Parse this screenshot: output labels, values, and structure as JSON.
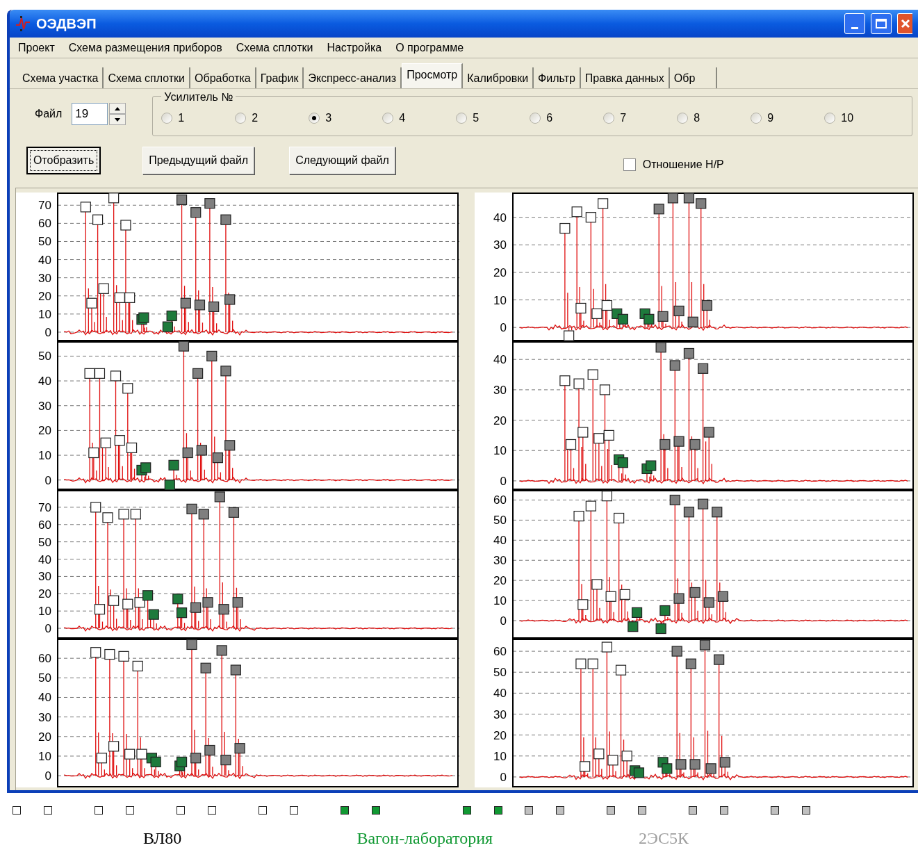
{
  "window": {
    "title": "ОЭДВЭП"
  },
  "menu": [
    "Проект",
    "Схема размещения приборов",
    "Схема сплотки",
    "Настройка",
    "О программе"
  ],
  "tabs": [
    {
      "label": "Схема участка",
      "selected": false
    },
    {
      "label": "Схема сплотки",
      "selected": false
    },
    {
      "label": "Обработка",
      "selected": false
    },
    {
      "label": "График",
      "selected": false
    },
    {
      "label": "Экспресс-анализ",
      "selected": false
    },
    {
      "label": "Просмотр",
      "selected": true
    },
    {
      "label": "Калибровки",
      "selected": false
    },
    {
      "label": "Фильтр",
      "selected": false
    },
    {
      "label": "Правка данных",
      "selected": false
    },
    {
      "label": "Обр",
      "selected": false
    }
  ],
  "file": {
    "label": "Файл",
    "value": "19"
  },
  "amplifier": {
    "label": "Усилитель №",
    "options": [
      {
        "label": "1",
        "selected": false
      },
      {
        "label": "2",
        "selected": false
      },
      {
        "label": "3",
        "selected": true
      },
      {
        "label": "4",
        "selected": false
      },
      {
        "label": "5",
        "selected": false
      },
      {
        "label": "6",
        "selected": false
      },
      {
        "label": "7",
        "selected": false
      },
      {
        "label": "8",
        "selected": false
      },
      {
        "label": "9",
        "selected": false
      },
      {
        "label": "10",
        "selected": false
      }
    ]
  },
  "buttons": [
    {
      "label": "Отобразить",
      "focused": true
    },
    {
      "label": "Предыдущий файл",
      "focused": false
    },
    {
      "label": "Следующий файл",
      "focused": false
    }
  ],
  "ratio_checkbox": {
    "label": "Отношение Н/Р",
    "checked": false
  },
  "chart_columns": [
    {
      "charts": [
        {
          "y_labels": [
            "70",
            "60",
            "50",
            "40",
            "30",
            "20",
            "10",
            "0"
          ]
        },
        {
          "y_labels": [
            "50",
            "40",
            "30",
            "20",
            "10",
            "0"
          ]
        },
        {
          "y_labels": [
            "70",
            "60",
            "50",
            "40",
            "30",
            "20",
            "10",
            "0"
          ]
        },
        {
          "y_labels": [
            "60",
            "50",
            "40",
            "30",
            "20",
            "10",
            "0"
          ]
        }
      ]
    },
    {
      "charts": [
        {
          "y_labels": [
            "40",
            "30",
            "20",
            "10",
            "0"
          ]
        },
        {
          "y_labels": [
            "40",
            "30",
            "20",
            "10",
            "0"
          ]
        },
        {
          "y_labels": [
            "60",
            "50",
            "40",
            "30",
            "20",
            "10",
            "0"
          ]
        },
        {
          "y_labels": [
            "60",
            "50",
            "40",
            "30",
            "20",
            "10",
            "0"
          ]
        }
      ]
    }
  ],
  "legend": {
    "markers": [
      {
        "color": "#ffffff"
      },
      {
        "color": "#ffffff"
      },
      {
        "color": "#ffffff"
      },
      {
        "color": "#ffffff"
      },
      {
        "color": "#ffffff"
      },
      {
        "color": "#ffffff"
      },
      {
        "color": "#ffffff"
      },
      {
        "color": "#ffffff"
      },
      {
        "color": "#119933"
      },
      {
        "color": "#119933"
      },
      {
        "color": "#119933"
      },
      {
        "color": "#119933"
      },
      {
        "color": "#c0c0c0"
      },
      {
        "color": "#c0c0c0"
      },
      {
        "color": "#c0c0c0"
      },
      {
        "color": "#c0c0c0"
      },
      {
        "color": "#c0c0c0"
      },
      {
        "color": "#c0c0c0"
      },
      {
        "color": "#c0c0c0"
      },
      {
        "color": "#c0c0c0"
      }
    ],
    "labels": [
      {
        "text": "ВЛ80",
        "color": "#000000"
      },
      {
        "text": "Вагон-лаборатория",
        "color": "#119933"
      },
      {
        "text": "2ЭС5К",
        "color": "#a0a0a0"
      }
    ]
  }
}
